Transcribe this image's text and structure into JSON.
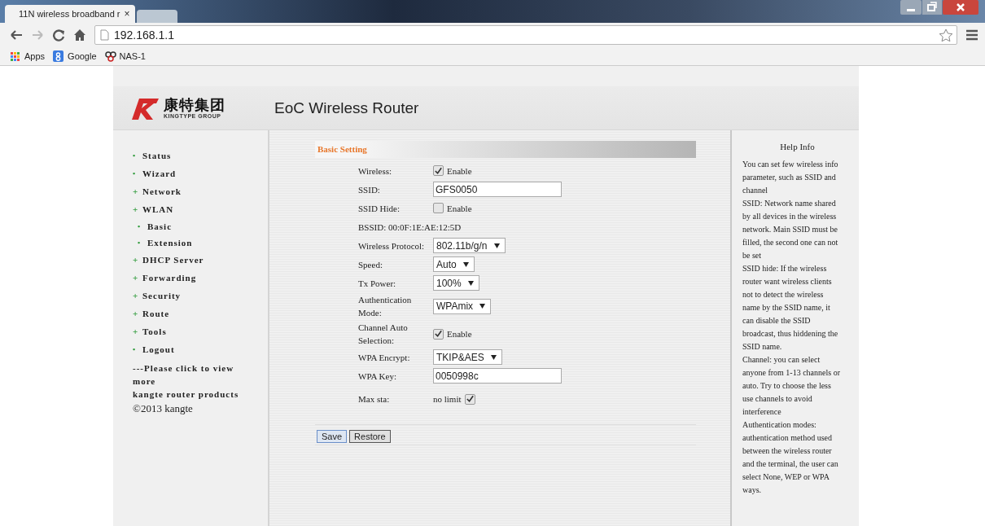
{
  "browser": {
    "tabs": [
      {
        "title": "11N wireless broadband r",
        "close": "×",
        "selected": true
      },
      {
        "selected": false
      }
    ],
    "address": "192.168.1.1",
    "bookmarks": [
      {
        "label": "Apps",
        "kind": "apps"
      },
      {
        "label": "Google",
        "kind": "google"
      },
      {
        "label": "NAS-1",
        "kind": "nas"
      }
    ]
  },
  "header": {
    "logo_cn": "康特集团",
    "logo_en": "KINGTYPE GROUP",
    "title": "EoC Wireless Router"
  },
  "sidebar": {
    "items": [
      {
        "marker": "•",
        "label": "Status"
      },
      {
        "marker": "•",
        "label": "Wizard"
      },
      {
        "marker": "+",
        "label": "Network"
      },
      {
        "marker": "+",
        "label": "WLAN",
        "children": [
          {
            "marker": "•",
            "label": "Basic"
          },
          {
            "marker": "•",
            "label": "Extension"
          }
        ]
      },
      {
        "marker": "+",
        "label": "DHCP Server"
      },
      {
        "marker": "+",
        "label": "Forwarding"
      },
      {
        "marker": "+",
        "label": "Security"
      },
      {
        "marker": "+",
        "label": "Route"
      },
      {
        "marker": "+",
        "label": "Tools"
      },
      {
        "marker": "•",
        "label": "Logout"
      }
    ],
    "promo": [
      "---Please click to view more",
      "kangte router products"
    ],
    "copyright": "©2013 kangte"
  },
  "form": {
    "title": "Basic Setting",
    "rows": [
      {
        "kind": "checkbox",
        "label": "Wireless:",
        "checked": true,
        "text": "Enable"
      },
      {
        "kind": "text",
        "label": "SSID:",
        "value": "GFS0050"
      },
      {
        "kind": "checkbox",
        "label": "SSID Hide:",
        "checked": false,
        "text": "Enable"
      },
      {
        "kind": "info",
        "label": "BSSID: 00:0F:1E:AE:12:5D"
      },
      {
        "kind": "select",
        "label": "Wireless Protocol:",
        "value": "802.11b/g/n"
      },
      {
        "kind": "select",
        "label": "Speed:",
        "value": "Auto"
      },
      {
        "kind": "select",
        "label": "Tx Power:",
        "value": "100%"
      },
      {
        "kind": "select",
        "label": "Authentication Mode:",
        "value": "WPAmix"
      },
      {
        "kind": "checkbox",
        "label": "Channel Auto Selection:",
        "checked": true,
        "text": "Enable"
      },
      {
        "kind": "select",
        "label": "WPA Encrypt:",
        "value": "TKIP&AES"
      },
      {
        "kind": "text",
        "label": "WPA Key:",
        "value": "0050998c"
      },
      {
        "kind": "checkbox_after",
        "label": "Max sta:",
        "checked": true,
        "text": "no limit"
      }
    ],
    "buttons": [
      {
        "label": "Save",
        "selected": true
      },
      {
        "label": "Restore",
        "selected": false
      }
    ]
  },
  "help": {
    "title": "Help Info",
    "paragraphs": [
      "You can set few wireless info parameter, such as SSID and channel",
      "SSID: Network name shared by all devices in the wireless network. Main SSID must be filled, the second one can not be set",
      "SSID hide: If the wireless router want wireless clients not to detect the wireless name by the SSID name, it can disable the SSID broadcast, thus hiddening the SSID name.",
      "Channel: you can select anyone from 1-13 channels or auto. Try to choose the less use channels to avoid interference",
      "Authentication modes: authentication method used between the wireless router and the terminal, the user can select None, WEP or WPA ways."
    ]
  }
}
